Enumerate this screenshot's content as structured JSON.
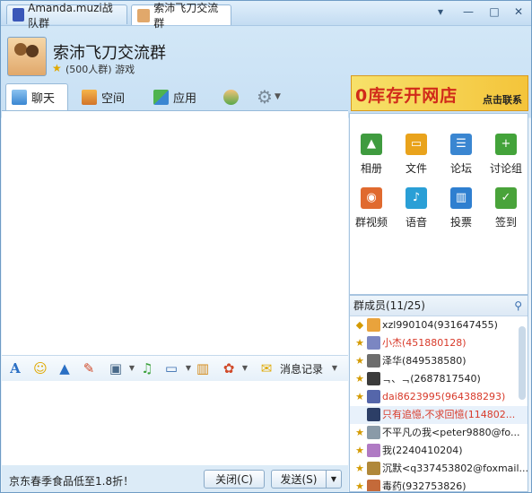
{
  "window": {
    "tabs": [
      {
        "label": "Amanda.muzi战队群",
        "active": false
      },
      {
        "label": "索沛飞刀交流群",
        "active": true
      }
    ],
    "buttons": {
      "menu": "▾",
      "minimize": "—",
      "maximize": "□",
      "close": "✕"
    }
  },
  "group": {
    "name": "索沛飞刀交流群",
    "subtitle": "(500人群) 游戏"
  },
  "nav": {
    "chat": "聊天",
    "space": "空间",
    "apps": "应用"
  },
  "banner": {
    "main": "0库存开网店",
    "cta": "点击联系"
  },
  "toolbar": {
    "history": "消息记录"
  },
  "bottom": {
    "ad": "京东春季食品低至1.8折！",
    "close": "关闭(C)",
    "send": "发送(S)"
  },
  "apps": [
    {
      "label": "相册",
      "color": "#3f9b3f"
    },
    {
      "label": "文件",
      "color": "#e9a31c"
    },
    {
      "label": "论坛",
      "color": "#3a86d1"
    },
    {
      "label": "讨论组",
      "color": "#43a33a"
    },
    {
      "label": "群视频",
      "color": "#e06a2f"
    },
    {
      "label": "语音",
      "color": "#2a9fd6"
    },
    {
      "label": "投票",
      "color": "#2f7fd0"
    },
    {
      "label": "签到",
      "color": "#49a33a"
    }
  ],
  "members": {
    "header": "群成员(11/25)",
    "list": [
      {
        "name": "xzl990104(931647455)",
        "color": "#222222",
        "avatar": "#e9a33c"
      },
      {
        "name": "小杰(451880128)",
        "color": "#d83a2a",
        "avatar": "#7b86c2"
      },
      {
        "name": "泽华(849538580)",
        "color": "#222222",
        "avatar": "#6e6e6e"
      },
      {
        "name": "ᆨ、ᆨ(2687817540)",
        "color": "#222222",
        "avatar": "#3c3c3c"
      },
      {
        "name": "dai8623995(964388293)",
        "color": "#d83a2a",
        "avatar": "#5566aa"
      },
      {
        "name": "只有追憶,不求回憶(114802...",
        "color": "#d83a2a",
        "avatar": "#2c3e66"
      },
      {
        "name": "不平凡の我<peter9880@fo...",
        "color": "#222222",
        "avatar": "#8a9aa8"
      },
      {
        "name": "我(2240410204)",
        "color": "#222222",
        "avatar": "#b07ac4"
      },
      {
        "name": "沉默<q337453802@foxmail....",
        "color": "#222222",
        "avatar": "#b0883a"
      },
      {
        "name": "毒药(932753826)",
        "color": "#222222",
        "avatar": "#c46a3a"
      }
    ]
  }
}
